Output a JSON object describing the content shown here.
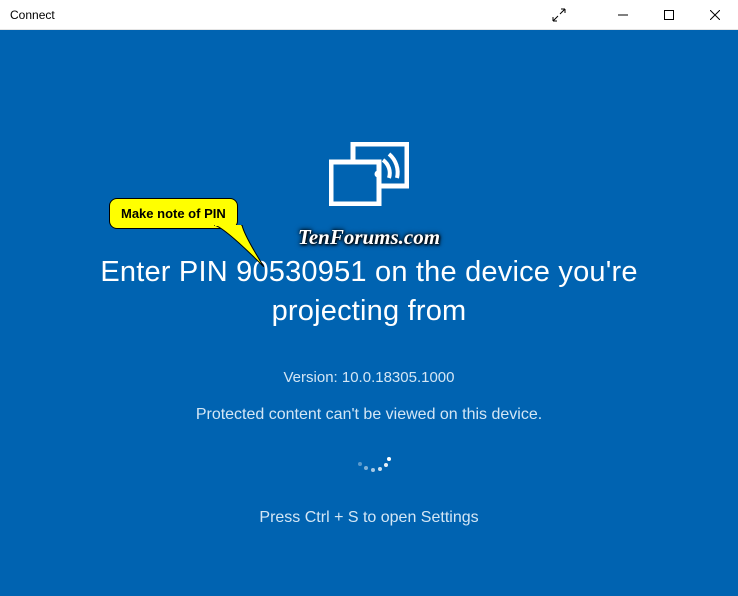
{
  "window": {
    "title": "Connect"
  },
  "content": {
    "pin": "90530951",
    "pin_heading_prefix": "Enter PIN ",
    "pin_heading_suffix": " on the device you're projecting from",
    "version_label": "Version: ",
    "version_value": "10.0.18305.1000",
    "protected_text": "Protected content can't be viewed on this device.",
    "settings_hint": "Press Ctrl + S to open Settings"
  },
  "annotation": {
    "callout_text": "Make note of PIN",
    "watermark": "TenForums.com"
  }
}
